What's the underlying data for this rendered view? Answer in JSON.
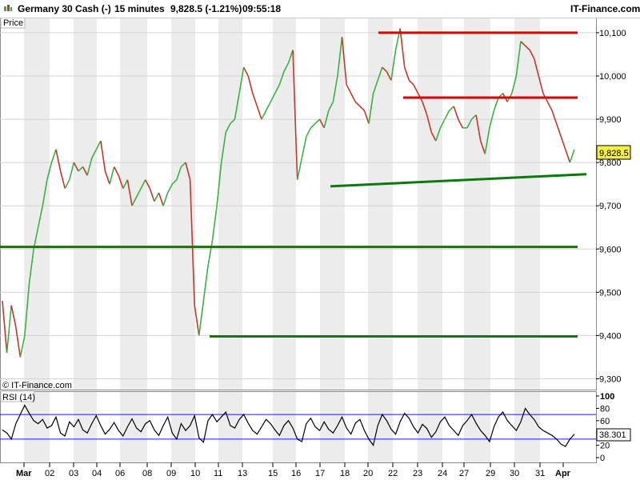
{
  "header": {
    "instrument": "Germany 30 Cash (-)",
    "timeframe": "15 minutes",
    "last_change": "9,828.5 (-1.21%)",
    "time": "09:55:18",
    "brand": "IT-Finance.com"
  },
  "price_panel": {
    "label": "Price",
    "copyright": "© IT-Finance.com",
    "current_price_label": "9,828.5",
    "current_price": 9828.5
  },
  "rsi_panel": {
    "label": "RSI (14)",
    "current_value_label": "38.301",
    "current_value": 38.3
  },
  "colors": {
    "up_candle": "#3cb043",
    "down_candle": "#c0392b",
    "resistance_line": "#e00000",
    "support_line": "#0a7a0a",
    "rsi_band": "#1a1aff",
    "shade": "#ececec"
  },
  "chart_data": [
    {
      "type": "line",
      "title": "Germany 30 Cash (-)",
      "description_source": "price panel (candlesticks approximated as close path)",
      "y_ticks": [
        "9,300",
        "9,400",
        "9,500",
        "9,600",
        "9,700",
        "9,800",
        "9,900",
        "10,000",
        "10,100"
      ],
      "y_tick_values": [
        9300,
        9400,
        9500,
        9600,
        9700,
        9800,
        9900,
        10000,
        10100
      ],
      "ylim": [
        9275,
        10135
      ],
      "x_tick_labels": [
        "Mar",
        "02",
        "03",
        "04",
        "06",
        "08",
        "09",
        "10",
        "11",
        "13",
        "15",
        "16",
        "17",
        "18",
        "20",
        "22",
        "23",
        "24",
        "27",
        "29",
        "30",
        "31",
        "Apr"
      ],
      "bold_x_tick_labels": [
        "Mar",
        "Apr"
      ],
      "series": [
        {
          "values": [
            9480,
            9360,
            9470,
            9420,
            9350,
            9400,
            9520,
            9600,
            9650,
            9700,
            9760,
            9800,
            9830,
            9780,
            9740,
            9760,
            9800,
            9780,
            9790,
            9770,
            9810,
            9830,
            9850,
            9780,
            9750,
            9790,
            9770,
            9740,
            9760,
            9700,
            9720,
            9740,
            9760,
            9740,
            9710,
            9730,
            9700,
            9730,
            9750,
            9760,
            9790,
            9800,
            9760,
            9470,
            9400,
            9480,
            9560,
            9620,
            9700,
            9800,
            9870,
            9890,
            9900,
            9960,
            10020,
            10000,
            9960,
            9930,
            9900,
            9920,
            9940,
            9960,
            9980,
            10010,
            10030,
            10060,
            9760,
            9810,
            9860,
            9880,
            9890,
            9900,
            9880,
            9920,
            9940,
            10000,
            10090,
            9980,
            9960,
            9940,
            9930,
            9920,
            9890,
            9960,
            9990,
            10020,
            10010,
            9990,
            10060,
            10110,
            10020,
            9990,
            9980,
            9960,
            9940,
            9910,
            9870,
            9850,
            9880,
            9900,
            9920,
            9930,
            9900,
            9880,
            9880,
            9900,
            9910,
            9850,
            9820,
            9880,
            9920,
            9950,
            9960,
            9940,
            9960,
            10000,
            10080,
            10070,
            10060,
            10040,
            10000,
            9960,
            9940,
            9920,
            9890,
            9860,
            9830,
            9800,
            9830
          ]
        }
      ],
      "resistance_lines": [
        {
          "from": "20",
          "to": "31",
          "value": 10100
        },
        {
          "from": "22",
          "to": "31",
          "value": 9950
        }
      ],
      "support_lines": [
        {
          "value": 9605,
          "span": "full"
        },
        {
          "from": "10",
          "to": "31",
          "value": 9398
        },
        {
          "from": "17",
          "to": "31",
          "start_value": 9745,
          "end_value": 9773
        }
      ]
    },
    {
      "type": "line",
      "title": "RSI (14)",
      "y_ticks": [
        "0",
        "20",
        "40",
        "60",
        "80",
        "100"
      ],
      "y_tick_values": [
        0,
        20,
        40,
        60,
        80,
        100
      ],
      "ylim": [
        0,
        100
      ],
      "band_levels": [
        30,
        70
      ],
      "series": [
        {
          "values": [
            45,
            40,
            30,
            55,
            70,
            85,
            72,
            60,
            55,
            62,
            48,
            52,
            66,
            40,
            35,
            58,
            50,
            62,
            45,
            40,
            55,
            68,
            52,
            38,
            46,
            57,
            44,
            35,
            50,
            63,
            48,
            42,
            55,
            60,
            45,
            36,
            52,
            66,
            40,
            30,
            55,
            44,
            52,
            68,
            32,
            25,
            60,
            70,
            58,
            66,
            74,
            52,
            48,
            62,
            70,
            56,
            44,
            38,
            50,
            62,
            55,
            45,
            36,
            52,
            60,
            48,
            30,
            26,
            55,
            64,
            50,
            44,
            58,
            46,
            40,
            52,
            66,
            48,
            38,
            56,
            62,
            44,
            30,
            20,
            52,
            70,
            60,
            46,
            38,
            58,
            72,
            64,
            50,
            40,
            54,
            47,
            33,
            42,
            58,
            66,
            52,
            44,
            36,
            52,
            60,
            70,
            56,
            44,
            36,
            26,
            50,
            66,
            74,
            60,
            52,
            44,
            58,
            80,
            70,
            62,
            50,
            44,
            40,
            36,
            30,
            22,
            18,
            30,
            38
          ]
        }
      ]
    }
  ]
}
